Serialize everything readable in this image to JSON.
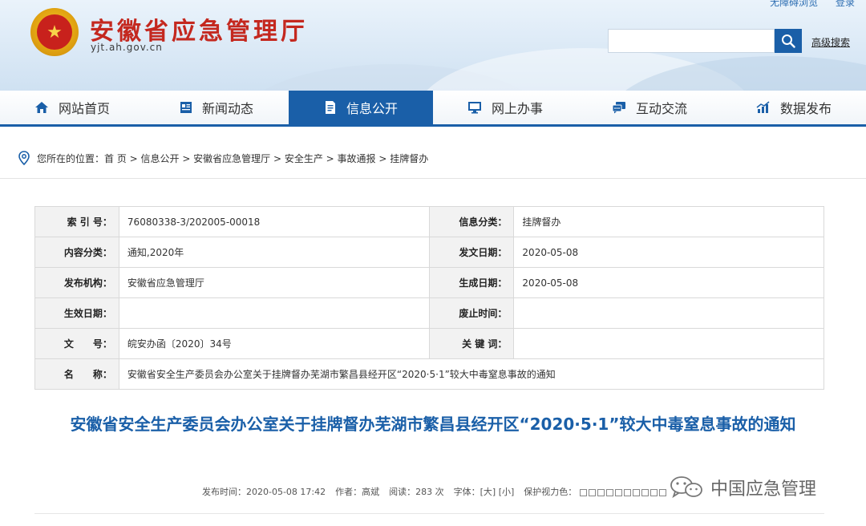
{
  "header": {
    "site_title": "安徽省应急管理厅",
    "site_domain": "yjt.ah.gov.cn",
    "top_links": [
      "无障碍浏览",
      "登录"
    ],
    "search_placeholder": "",
    "advanced_search": "高级搜索",
    "emblem_icon": "national-emblem-icon"
  },
  "nav": {
    "items": [
      {
        "label": "网站首页",
        "icon": "home-icon"
      },
      {
        "label": "新闻动态",
        "icon": "news-icon"
      },
      {
        "label": "信息公开",
        "icon": "document-icon",
        "active": true
      },
      {
        "label": "网上办事",
        "icon": "monitor-icon"
      },
      {
        "label": "互动交流",
        "icon": "chat-icon"
      },
      {
        "label": "数据发布",
        "icon": "chart-icon"
      }
    ],
    "active_color": "#1a5fa8"
  },
  "breadcrumb": {
    "text": "您所在的位置：首 页 > 信息公开 > 安徽省应急管理厅 > 安全生产 > 事故通报 > 挂牌督办"
  },
  "meta": {
    "rows": [
      {
        "l1": "索 引 号：",
        "v1": "76080338-3/202005-00018",
        "l2": "信息分类：",
        "v2": "挂牌督办"
      },
      {
        "l1": "内容分类：",
        "v1": "通知,2020年",
        "l2": "发文日期：",
        "v2": "2020-05-08"
      },
      {
        "l1": "发布机构：",
        "v1": "安徽省应急管理厅",
        "l2": "生成日期：",
        "v2": "2020-05-08"
      },
      {
        "l1": "生效日期：",
        "v1": "",
        "l2": "废止时间：",
        "v2": ""
      },
      {
        "l1": "文　　号：",
        "v1": "皖安办函〔2020〕34号",
        "l2": "关 键 词：",
        "v2": ""
      }
    ],
    "name_label": "名　　称：",
    "name_value": "安徽省安全生产委员会办公室关于挂牌督办芜湖市繁昌县经开区“2020·5·1”较大中毒窒息事故的通知"
  },
  "article": {
    "title": "安徽省安全生产委员会办公室关于挂牌督办芜湖市繁昌县经开区“2020·5·1”较大中毒窒息事故的通知",
    "publish_time": "发布时间：2020-05-08 17:42",
    "author": "作者：高斌",
    "views": "阅读：283 次",
    "font_size": "字体：[大] [小]",
    "eye_protect": "保护视力色："
  },
  "watermark": {
    "text": "中国应急管理",
    "icon": "wechat-icon"
  }
}
